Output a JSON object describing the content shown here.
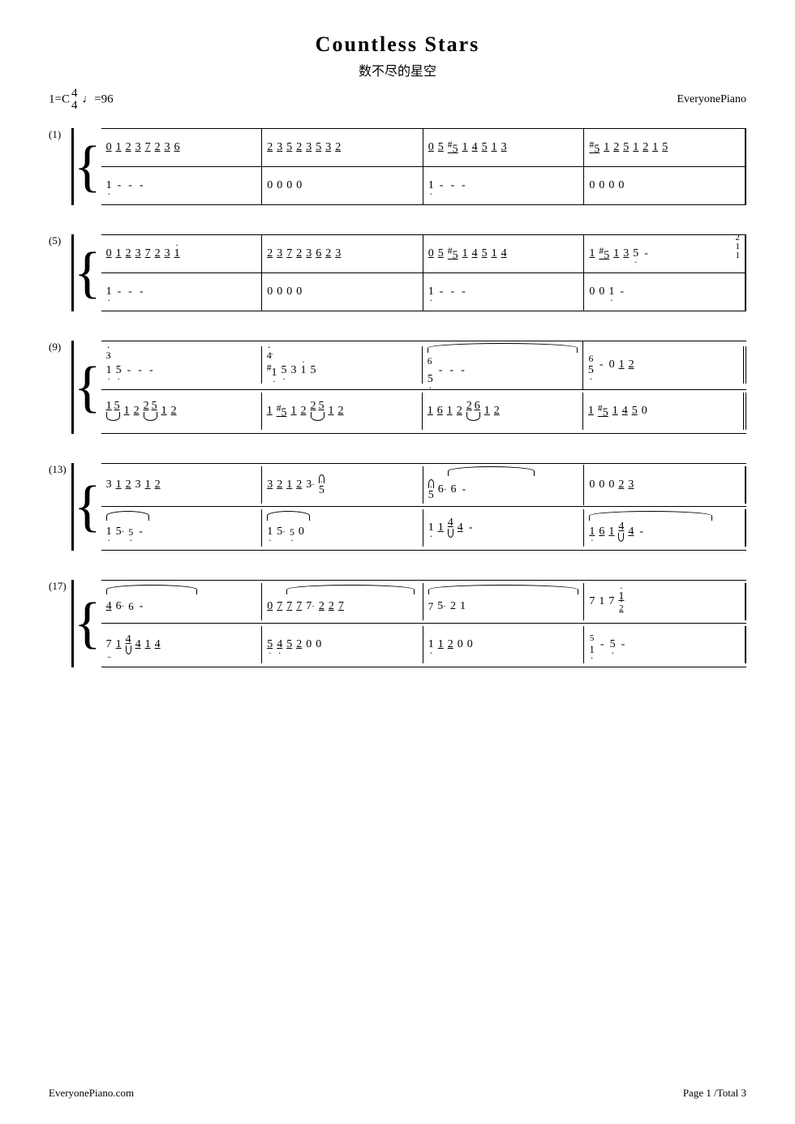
{
  "title": {
    "en": "Countless Stars",
    "cn": "数不尽的星空"
  },
  "meta": {
    "key": "1=C",
    "time": "4/4",
    "tempo": "♩=96",
    "publisher": "EveryonePiano"
  },
  "footer": {
    "website": "EveryonePiano.com",
    "page": "Page 1 /Total 3"
  },
  "sections": [
    {
      "num": "(1)"
    },
    {
      "num": "(5)"
    },
    {
      "num": "(9)"
    },
    {
      "num": "(13)"
    },
    {
      "num": "(17)"
    }
  ]
}
